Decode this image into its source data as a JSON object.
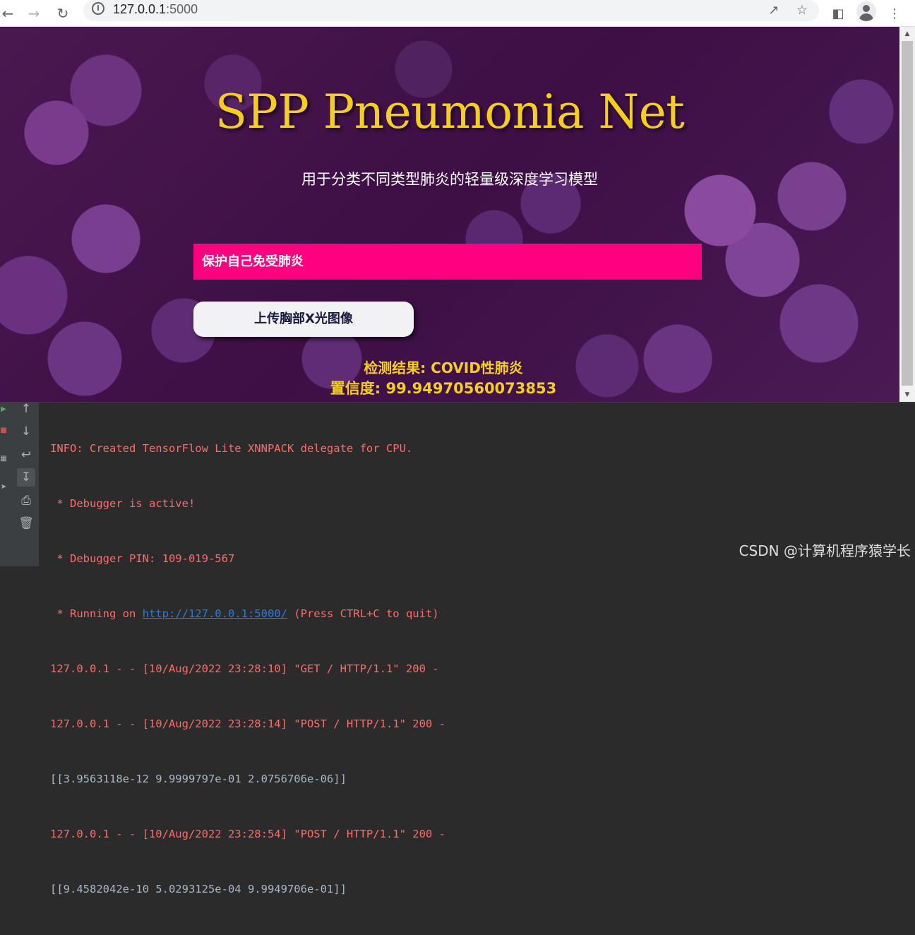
{
  "browser": {
    "url_host": "127.0.0.1",
    "url_port": ":5000",
    "icons": {
      "back": "back-arrow-icon",
      "forward": "forward-arrow-icon",
      "reload": "reload-icon",
      "info": "info-icon",
      "share": "share-icon",
      "bookmark": "star-icon",
      "sidepanel": "side-panel-icon",
      "profile": "profile-avatar-icon",
      "menu": "kebab-menu-icon"
    }
  },
  "page": {
    "title": "SPP Pneumonia Net",
    "subtitle": "用于分类不同类型肺炎的轻量级深度学习模型",
    "banner": "保护自己免受肺炎",
    "upload_button": "上传胸部X光图像",
    "result_line": "检测结果: COVID性肺炎",
    "confidence_line": "置信度: 99.94970560073853",
    "colors": {
      "title": "#f6cf1c",
      "banner_bg": "#ff0080",
      "result": "#f6cf1c"
    }
  },
  "console": {
    "lines": [
      {
        "text": "INFO: Created TensorFlow Lite XNNPACK delegate for CPU.",
        "color": "red"
      },
      {
        "text": " * Debugger is active!",
        "color": "red"
      },
      {
        "text": " * Debugger PIN: 109-019-567",
        "color": "red"
      },
      {
        "prefix": " * Running on ",
        "link": "http://127.0.0.1:5000/",
        "suffix": " (Press CTRL+C to quit)",
        "color": "red"
      },
      {
        "text": "127.0.0.1 - - [10/Aug/2022 23:28:10] \"GET / HTTP/1.1\" 200 -",
        "color": "red"
      },
      {
        "text": "127.0.0.1 - - [10/Aug/2022 23:28:14] \"POST / HTTP/1.1\" 200 -",
        "color": "red"
      },
      {
        "text": "[[3.9563118e-12 9.9999797e-01 2.0756706e-06]]",
        "color": "white"
      },
      {
        "text": "127.0.0.1 - - [10/Aug/2022 23:28:54] \"POST / HTTP/1.1\" 200 -",
        "color": "red"
      },
      {
        "text": "[[9.4582042e-10 5.0293125e-04 9.9949706e-01]]",
        "color": "white"
      }
    ],
    "tools": [
      "scroll-up-icon",
      "scroll-down-icon",
      "soft-wrap-icon",
      "scroll-to-end-icon",
      "print-icon",
      "trash-icon"
    ]
  },
  "watermark": "CSDN @计算机程序猿学长"
}
